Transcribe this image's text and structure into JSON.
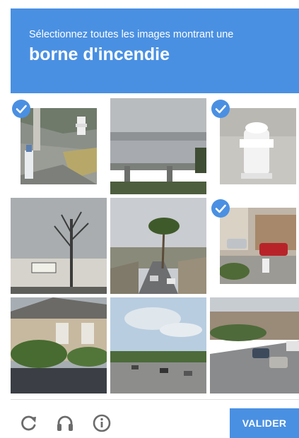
{
  "header": {
    "instruction": "Sélectionnez toutes les images montrant une",
    "target": "borne d'incendie",
    "background": "#4a90e2"
  },
  "grid": {
    "rows": 3,
    "columns": 3,
    "tiles": [
      {
        "scene": "street corner with white fire hydrant",
        "selected": true
      },
      {
        "scene": "bridge railing over water",
        "selected": false
      },
      {
        "scene": "white fire hydrant on sidewalk",
        "selected": true
      },
      {
        "scene": "bare tree and exit sign",
        "selected": false
      },
      {
        "scene": "palm tree over a street",
        "selected": false
      },
      {
        "scene": "fire hydrant near parked cars",
        "selected": true
      },
      {
        "scene": "house with green bushes",
        "selected": false
      },
      {
        "scene": "highway with traffic",
        "selected": false
      },
      {
        "scene": "city road with cars",
        "selected": false
      }
    ]
  },
  "footer": {
    "reload_icon": "reload-icon",
    "audio_icon": "headphones-icon",
    "info_icon": "info-icon",
    "verify_label": "VALIDER",
    "verify_color": "#4a90e2"
  }
}
